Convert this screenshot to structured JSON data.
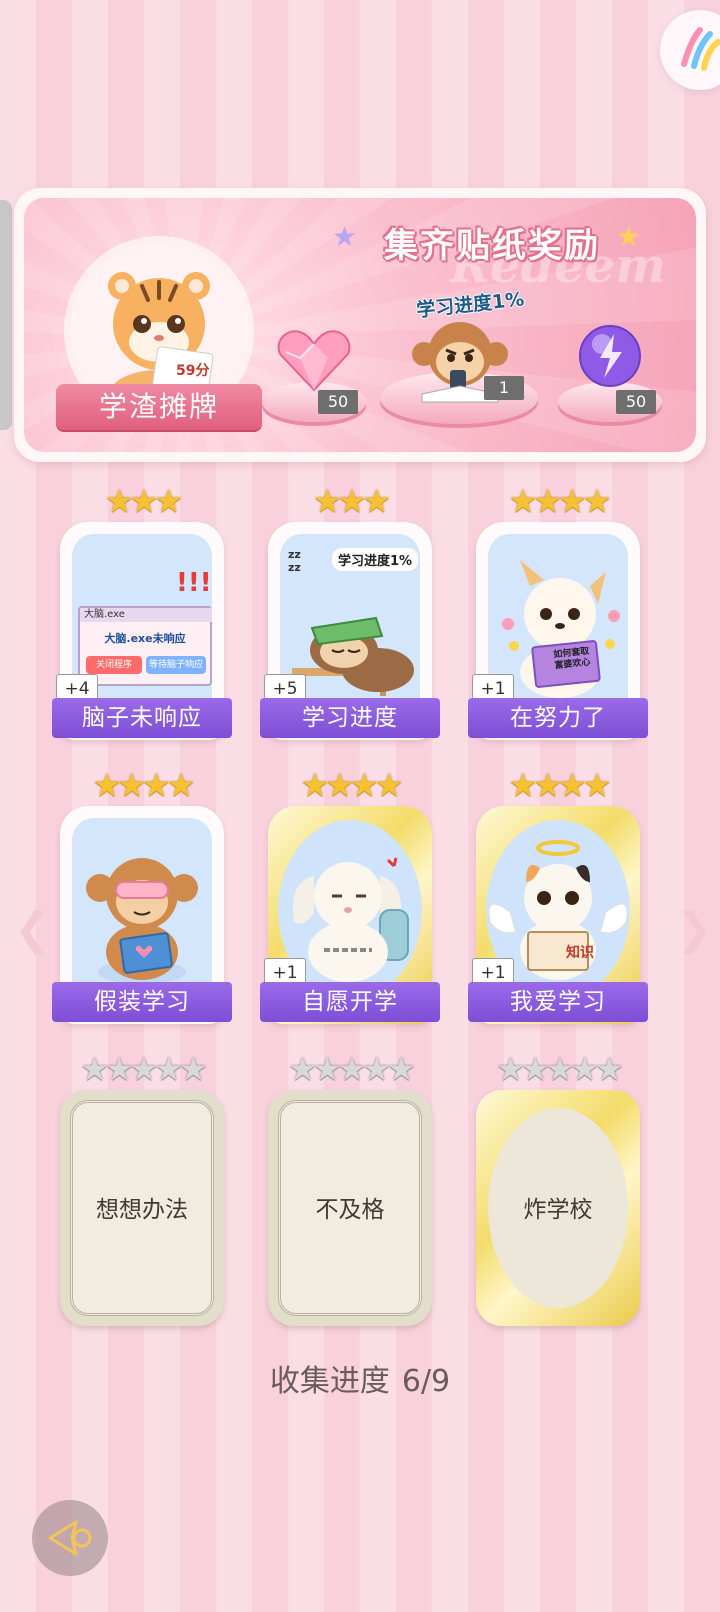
{
  "banner": {
    "title": "集齐贴纸奖励",
    "watermark": "Redeem",
    "main_reward": {
      "label": "学渣摊牌",
      "paper_text": "59分"
    },
    "rewards": [
      {
        "icon": "pink-heart-gem-icon",
        "count": "50"
      },
      {
        "icon": "monkey-sticker-icon",
        "caption": "学习进度1%",
        "count": "1"
      },
      {
        "icon": "purple-lightning-orb-icon",
        "count": "50"
      }
    ]
  },
  "cards": [
    {
      "name": "脑子未响应",
      "stars": 3,
      "bonus": "+4",
      "frame": "blue",
      "art_text_title": "大脑.exe",
      "art_text_main": "大脑.exe未响应",
      "art_btn1": "关闭程序",
      "art_btn2": "等待脑子响应"
    },
    {
      "name": "学习进度",
      "stars": 3,
      "bonus": "+5",
      "frame": "blue",
      "art_text_main": "学习进度1%"
    },
    {
      "name": "在努力了",
      "stars": 4,
      "bonus": "+1",
      "frame": "blue",
      "art_text_main": "如何套取富婆欢心"
    },
    {
      "name": "假装学习",
      "stars": 4,
      "bonus": "",
      "frame": "blue"
    },
    {
      "name": "自愿开学",
      "stars": 4,
      "bonus": "+1",
      "frame": "gold"
    },
    {
      "name": "我爱学习",
      "stars": 4,
      "bonus": "+1",
      "frame": "gold",
      "art_text_main": "知识"
    }
  ],
  "locked_cards": [
    {
      "name": "想想办法",
      "stars": 5,
      "frame": "plain"
    },
    {
      "name": "不及格",
      "stars": 5,
      "frame": "plain"
    },
    {
      "name": "炸学校",
      "stars": 5,
      "frame": "gold"
    }
  ],
  "progress": {
    "label": "收集进度",
    "value": "6/9"
  },
  "colors": {
    "label_purple": "#8b5cdf",
    "banner_pink": "#f5a3b8",
    "star_gold": "#f6c233"
  }
}
